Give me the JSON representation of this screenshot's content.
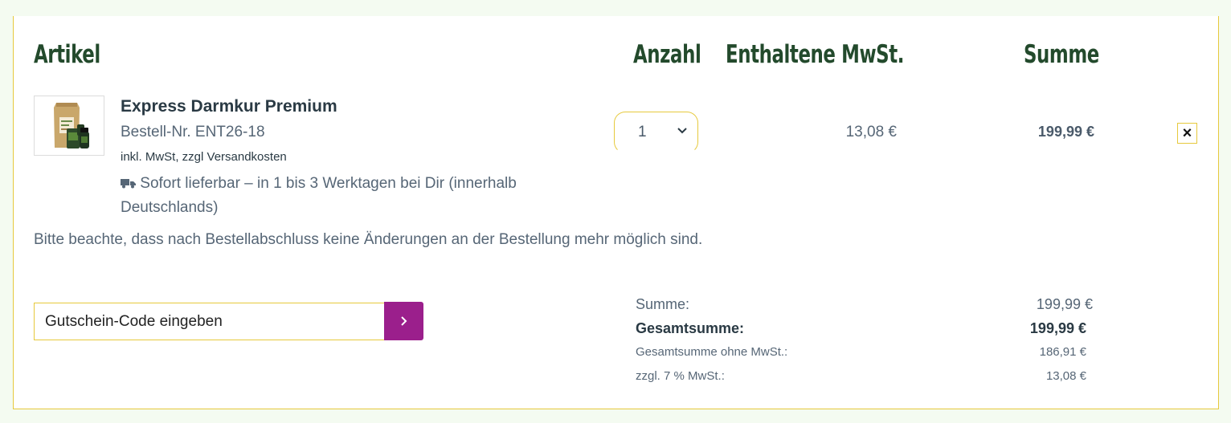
{
  "header": {
    "col_article": "Artikel",
    "col_quantity": "Anzahl",
    "col_tax": "Enthaltene MwSt.",
    "col_sum": "Summe"
  },
  "item": {
    "name": "Express Darmkur Premium",
    "sku": "Bestell-Nr. ENT26-18",
    "tax_note": "inkl. MwSt, zzgl Versandkosten",
    "delivery_icon": "truck-icon",
    "delivery": "Sofort lieferbar – in 1 bis 3 Werktagen bei Dir (innerhalb Deutschlands)",
    "quantity": "1",
    "tax_amount": "13,08 €",
    "line_sum": "199,99 €",
    "remove_label": "×"
  },
  "notice": "Bitte beachte, dass nach Bestellabschluss keine Änderungen an der Bestellung mehr möglich sind.",
  "coupon": {
    "placeholder": "Gutschein-Code eingeben",
    "submit_icon": "chevron-right-icon"
  },
  "totals": {
    "sum_label": "Summe:",
    "sum_value": "199,99 €",
    "grand_label": "Gesamtsumme:",
    "grand_value": "199,99 €",
    "net_label": "Gesamtsumme ohne MwSt.:",
    "net_value": "186,91 €",
    "vat_label": "zzgl. 7 % MwSt.:",
    "vat_value": "13,08 €"
  },
  "colors": {
    "heading": "#234a2c",
    "accent_border": "#e6c93c",
    "button": "#9b1f8c",
    "background": "#f4fbf1"
  }
}
